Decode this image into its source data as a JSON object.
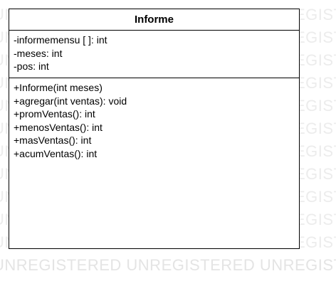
{
  "class": {
    "name": "Informe",
    "attributes": [
      "-informemensu [ ]: int",
      "-meses: int",
      "-pos: int"
    ],
    "operations": [
      "+Informe(int meses)",
      "+agregar(int ventas): void",
      "+promVentas(): int",
      "+menosVentas(): int",
      "+masVentas(): int",
      "+acumVentas(): int"
    ]
  },
  "watermark": {
    "text": "UNREGISTERED UNREGISTERED UNREGISTERED"
  }
}
